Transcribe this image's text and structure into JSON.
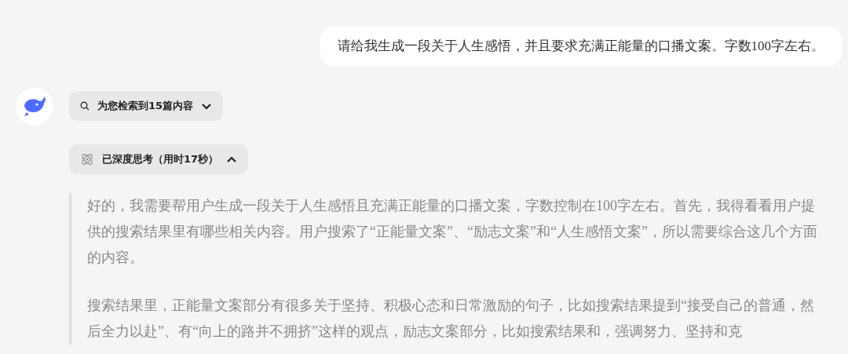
{
  "user_message": "请给我生成一段关于人生感悟，并且要求充满正能量的口播文案。字数100字左右。",
  "search_chip": {
    "label": "为您检索到15篇内容",
    "expanded": false
  },
  "thinking_chip": {
    "label": "已深度思考（用时17秒）",
    "expanded": true
  },
  "thinking_paragraphs": [
    "好的，我需要帮用户生成一段关于人生感悟且充满正能量的口播文案，字数控制在100字左右。首先，我得看看用户提供的搜索结果里有哪些相关内容。用户搜索了“正能量文案”、“励志文案”和“人生感悟文案”，所以需要综合这几个方面的内容。",
    "搜索结果里，正能量文案部分有很多关于坚持、积极心态和日常激励的句子，比如搜索结果提到“接受自己的普通，然后全力以赴”、有“向上的路并不拥挤”这样的观点，励志文案部分，比如搜索结果和，强调努力、坚持和克"
  ]
}
